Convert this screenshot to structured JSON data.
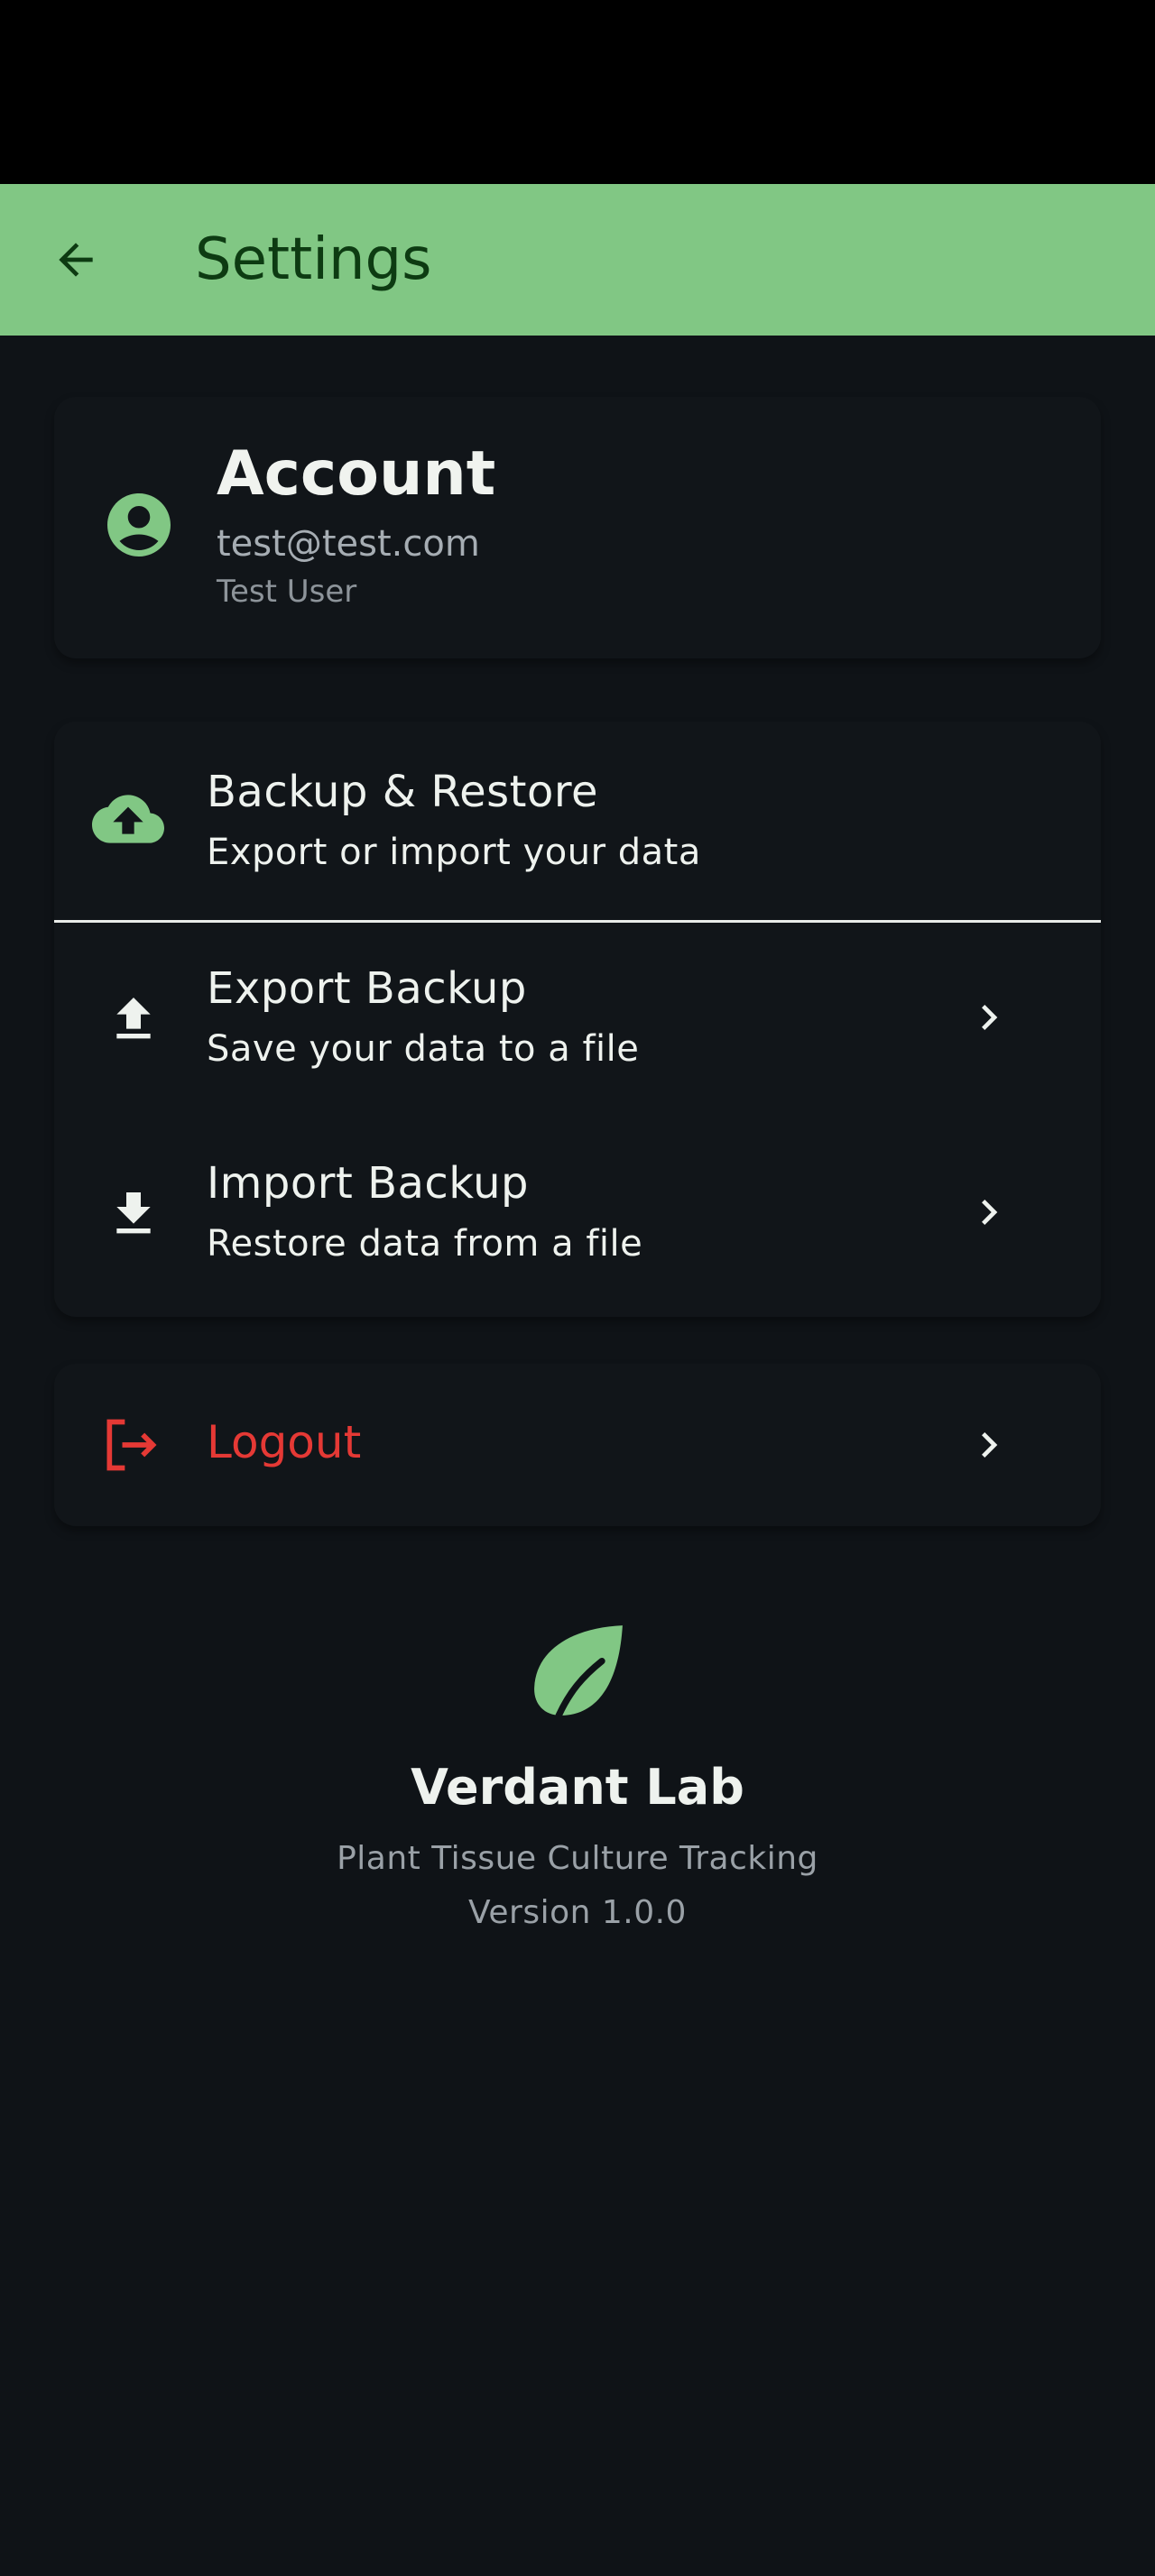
{
  "app_bar": {
    "title": "Settings"
  },
  "account": {
    "title": "Account",
    "email": "test@test.com",
    "name": "Test User"
  },
  "backup": {
    "title": "Backup & Restore",
    "subtitle": "Export or import your data",
    "export": {
      "title": "Export Backup",
      "subtitle": "Save your data to a file"
    },
    "import": {
      "title": "Import Backup",
      "subtitle": "Restore data from a file"
    }
  },
  "logout": {
    "label": "Logout"
  },
  "footer": {
    "app_name": "Verdant Lab",
    "tagline": "Plant Tissue Culture Tracking",
    "version": "Version 1.0.0"
  },
  "colors": {
    "app_bar": "#81c784",
    "accent": "#81c784",
    "danger": "#e53935",
    "background": "#0f1317"
  }
}
